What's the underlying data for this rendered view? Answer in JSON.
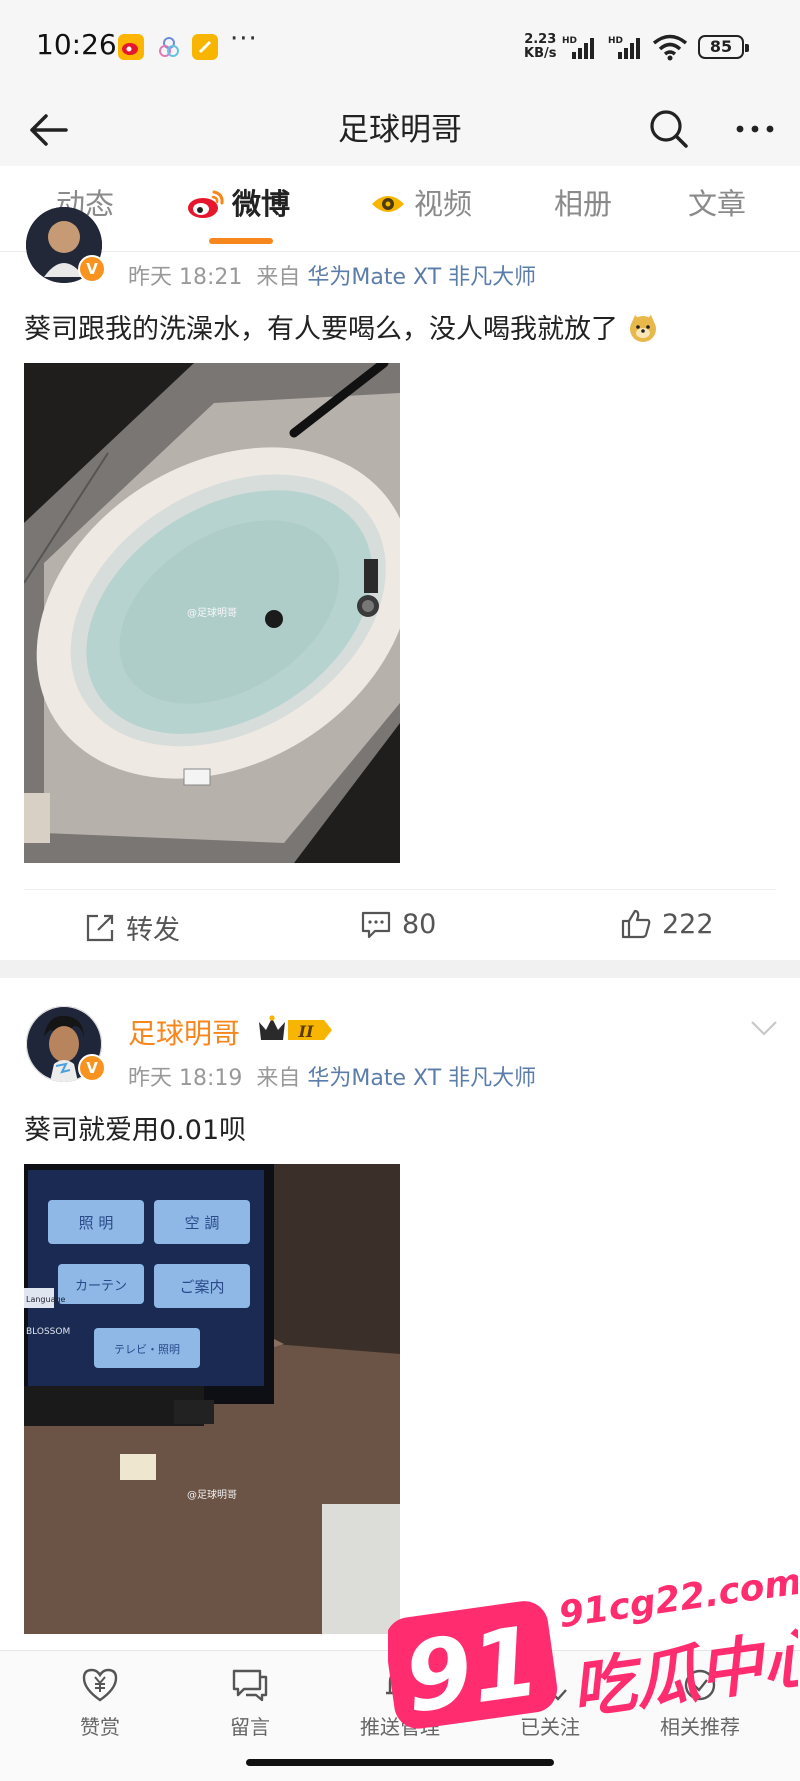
{
  "status_bar": {
    "time": "10:26",
    "more": "···",
    "net_speed_value": "2.23",
    "net_speed_unit": "KB/s",
    "battery": "85"
  },
  "header": {
    "title": "足球明哥"
  },
  "tabs": [
    {
      "label": "动态",
      "active": false
    },
    {
      "label": "微博",
      "active": true
    },
    {
      "label": "视频",
      "active": false
    },
    {
      "label": "相册",
      "active": false
    },
    {
      "label": "文章",
      "active": false
    }
  ],
  "post1": {
    "time": "昨天 18:21",
    "source_prefix": "来自",
    "source": "华为Mate XT 非凡大师",
    "text": "葵司跟我的洗澡水，有人要喝么，没人喝我就放了",
    "image_watermark": "@足球明哥",
    "actions": {
      "repost": "转发",
      "comments": "80",
      "likes": "222"
    }
  },
  "post2": {
    "username": "足球明哥",
    "level_badge": "II",
    "time": "昨天 18:19",
    "source_prefix": "来自",
    "source": "华为Mate XT 非凡大师",
    "text": "葵司就爱用0.01呗",
    "image_watermark": "@足球明哥",
    "panel_buttons": [
      "照 明",
      "空 調",
      "カーテン",
      "ご案内",
      "テレビ・照明"
    ],
    "panel_side": [
      "Language",
      "BLOSSOM"
    ]
  },
  "bottom_bar": [
    {
      "label": "赞赏",
      "icon": "yen-heart-icon"
    },
    {
      "label": "留言",
      "icon": "message-icon"
    },
    {
      "label": "推送管理",
      "icon": "bell-icon"
    },
    {
      "label": "已关注",
      "icon": "user-check-icon"
    },
    {
      "label": "相关推荐",
      "icon": "recommend-icon"
    }
  ],
  "watermark": {
    "site": "91cg22.com",
    "number": "91",
    "name": "吃瓜中心"
  },
  "colors": {
    "accent": "#f7861c",
    "link": "#5b7daa",
    "watermark": "#ff2d6f"
  }
}
